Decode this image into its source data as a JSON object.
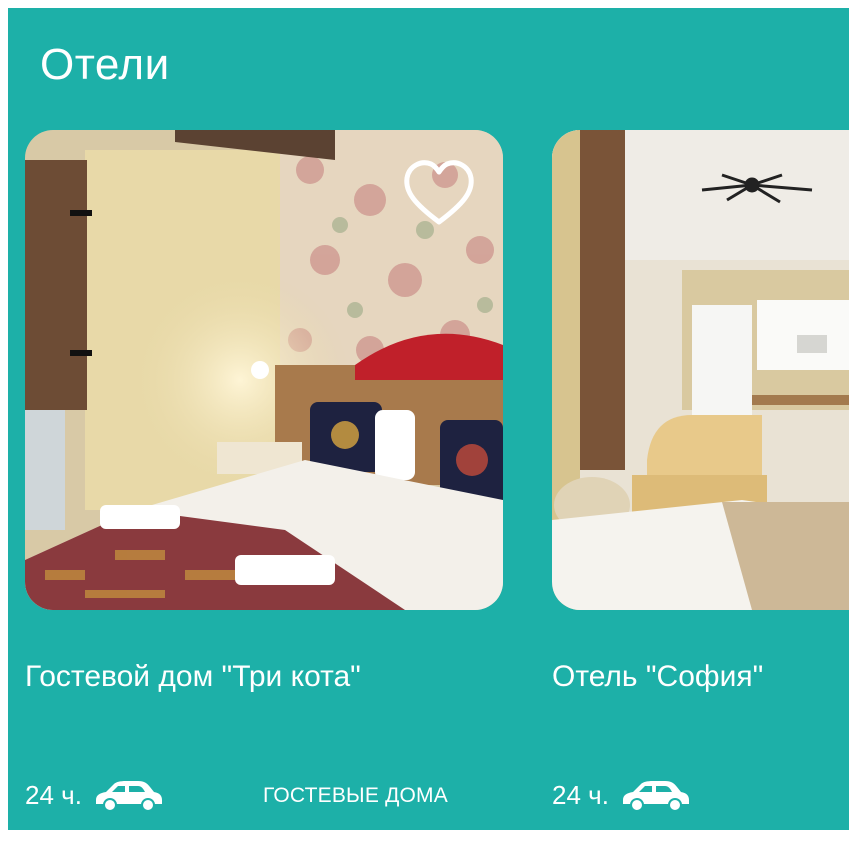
{
  "section": {
    "title": "Отели"
  },
  "colors": {
    "background": "#1db0a8",
    "text": "#ffffff"
  },
  "cards": [
    {
      "title": "Гостевой дом \"Три кота\"",
      "time": "24 ч.",
      "transport_icon": "car-icon",
      "category": "ГОСТЕВЫЕ ДОМА",
      "favorite_icon": "heart-outline-icon",
      "photo": "hotel-room-photo"
    },
    {
      "title": "Отель \"София\"",
      "time": "24 ч.",
      "transport_icon": "car-icon",
      "photo": "hotel-room-photo"
    }
  ]
}
